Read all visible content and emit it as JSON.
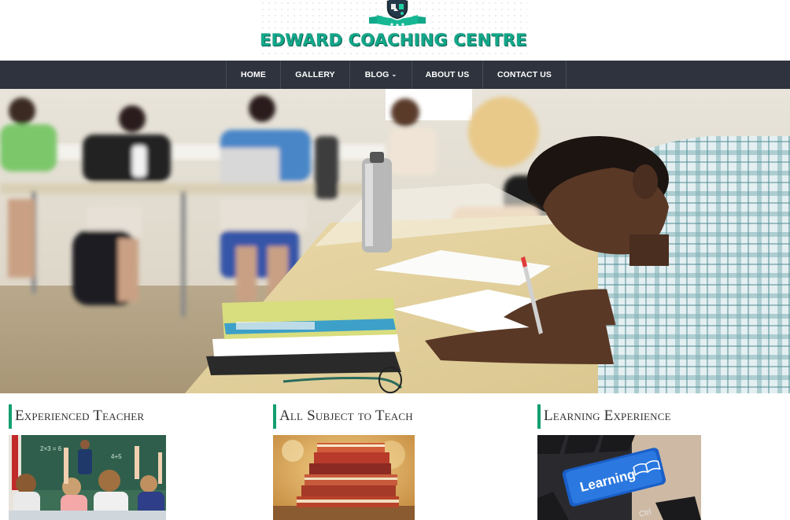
{
  "site": {
    "logo_text": "EDWARD COACHING CENTRE",
    "brand_color": "#12a88a"
  },
  "nav": {
    "items": [
      {
        "label": "HOME"
      },
      {
        "label": "GALLERY"
      },
      {
        "label": "BLOG",
        "has_dropdown": true,
        "icon": "chevron-down-icon"
      },
      {
        "label": "ABOUT US"
      },
      {
        "label": "CONTACT US"
      }
    ],
    "background": "#2e333d"
  },
  "features": [
    {
      "title": "Experienced Teacher",
      "image": "classroom-raised-hands"
    },
    {
      "title": "All Subject to Teach",
      "image": "stacked-books"
    },
    {
      "title": "Learning Experience",
      "image": "learning-keyboard-key",
      "key_label": "Learning",
      "ctrl_label": "Ctrl"
    }
  ],
  "accent_color": "#12a070"
}
